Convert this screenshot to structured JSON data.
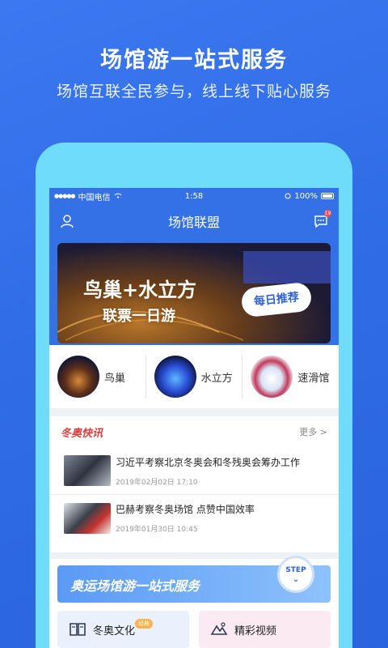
{
  "hero": {
    "title": "场馆游一站式服务",
    "subtitle": "场馆互联全民参与，线上线下贴心服务"
  },
  "statusbar": {
    "carrier": "中国电信",
    "time": "1:58",
    "battery": "100%"
  },
  "navbar": {
    "title": "场馆联盟",
    "badge_count": "19"
  },
  "banner": {
    "line1": "鸟巢+水立方",
    "line2": "联票一日游",
    "tag": "每日推荐"
  },
  "venues": [
    {
      "label": "鸟巢"
    },
    {
      "label": "水立方"
    },
    {
      "label": "速滑馆"
    }
  ],
  "news": {
    "title": "冬奥快讯",
    "more": "更多 >",
    "items": [
      {
        "headline": "习近平考察北京冬奥会和冬残奥会筹办工作",
        "date": "2019年02月02日  17:10"
      },
      {
        "headline": "巴赫考察冬奥场馆 点赞中国效率",
        "date": "2019年01月30日  10:45"
      }
    ]
  },
  "service": {
    "title": "奥运场馆游一站式服务",
    "step_label": "STEP",
    "cards": [
      {
        "label": "冬奥文化",
        "badge": "经典"
      },
      {
        "label": "精彩视频"
      }
    ]
  },
  "colors": {
    "brand_blue": "#3571e6",
    "phone_frame": "#6fdcfb",
    "news_red": "#e23c3c"
  }
}
